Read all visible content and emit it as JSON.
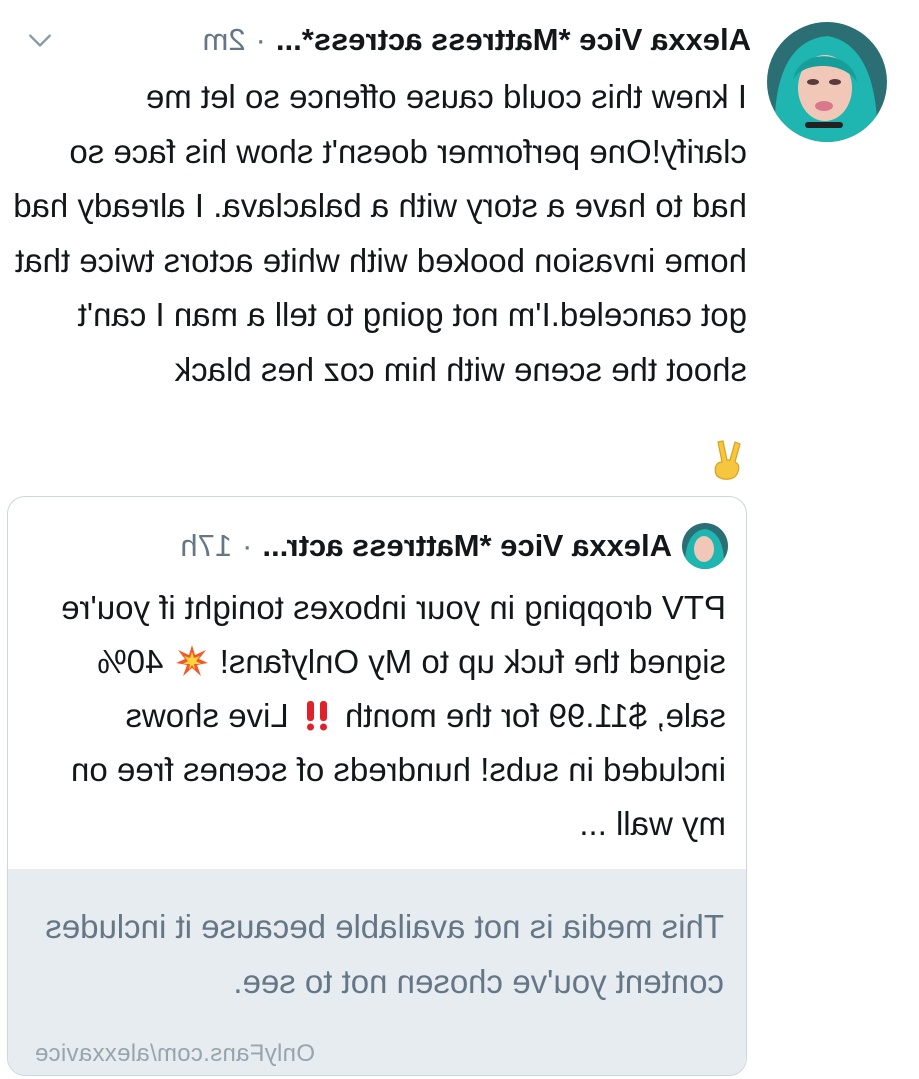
{
  "tweet": {
    "author_name": "Alexxa Vice *Mattress actress*...",
    "separator": "·",
    "time": "2m",
    "text": "I knew this could cause offence so let me clarify!One performer doesn't show his face so had to have a story with a balaclava. I already had home invasion booked with white actors twice that got canceled.I'm not going to tell a man I can't shoot the scene with him coz hes black",
    "trailing_emoji": "victory-hand-emoji",
    "menu_icon": "chevron-down-icon"
  },
  "quoted_tweet": {
    "author_name": "Alexxa Vice *Mattress actr...",
    "separator": "·",
    "time": "17h",
    "text_part1": "PTV dropping in your inboxes tonight if you're signed the fuck up to My Onlyfans!",
    "text_part2": "40% sale, $11.99 for the month",
    "text_part3": "Live shows included in subs! hundreds of scenes free on my wall ...",
    "media_notice": "This media is not available because it includes content you've chosen not to see."
  },
  "watermark": "OnlyFans.com/alexxavice",
  "colors": {
    "text_primary": "#14171a",
    "text_secondary": "#657786",
    "card_border": "#ccd6dd",
    "media_notice_bg": "#e6ecf0",
    "avatar_hair": "#1fb5b0"
  }
}
